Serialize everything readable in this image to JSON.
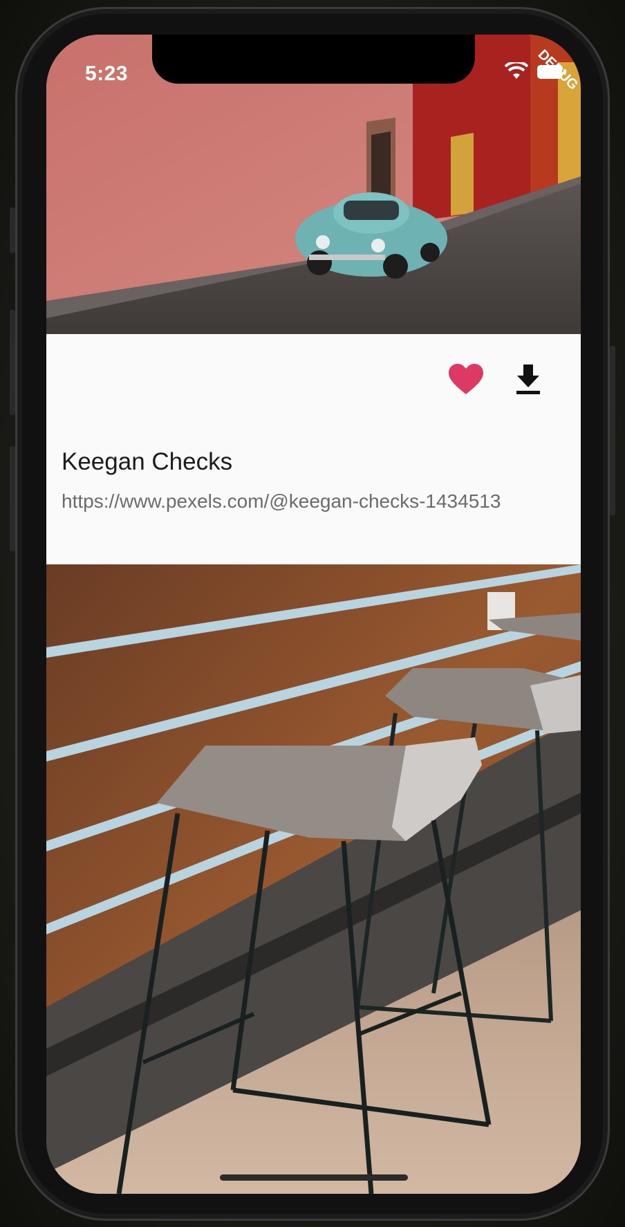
{
  "status_bar": {
    "time": "5:23",
    "debug_label": "DEBUG"
  },
  "icons": {
    "wifi": "wifi-icon",
    "battery": "battery-icon",
    "favorite": "heart-icon",
    "download": "download-icon"
  },
  "photos": [
    {
      "description_icon": "photo-car-street"
    },
    {
      "description_icon": "photo-bar-stools"
    }
  ],
  "card": {
    "author_name": "Keegan Checks",
    "author_url": "https://www.pexels.com/@keegan-checks-1434513"
  },
  "colors": {
    "favorite_active": "#dc3a64",
    "panel_bg": "#fafafa",
    "title_text": "#1b1b20",
    "url_text": "#6b6b6b"
  }
}
